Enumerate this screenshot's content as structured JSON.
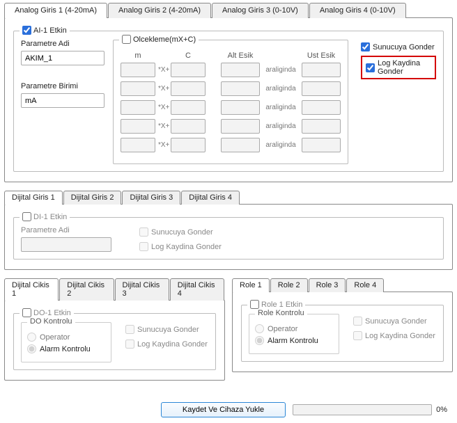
{
  "topTabs": [
    {
      "label": "Analog Giris 1 (4-20mA)"
    },
    {
      "label": "Analog Giris 2 (4-20mA)"
    },
    {
      "label": "Analog Giris 3 (0-10V)"
    },
    {
      "label": "Analog Giris 4 (0-10V)"
    }
  ],
  "ai": {
    "enabledLabel": "AI-1 Etkin",
    "paramNameLabel": "Parametre Adi",
    "paramNameValue": "AKIM_1",
    "paramUnitLabel": "Parametre Birimi",
    "paramUnitValue": "mA",
    "scalingLabel": "Olcekleme(mX+C)",
    "headers": {
      "m": "m",
      "c": "C",
      "altEsik": "Alt Esik",
      "ustEsik": "Ust Esik"
    },
    "rowOp1": "*X+",
    "rowOp2": "araliginda",
    "sunucuyaGonder": "Sunucuya Gonder",
    "logKaydinaGonder": "Log Kaydina Gonder"
  },
  "diTabs": [
    {
      "label": "Dijital Giris 1"
    },
    {
      "label": "Dijital Giris 2"
    },
    {
      "label": "Dijital Giris 3"
    },
    {
      "label": "Dijital Giris 4"
    }
  ],
  "di": {
    "enabledLabel": "DI-1 Etkin",
    "paramNameLabel": "Parametre Adi",
    "sunucuyaGonder": "Sunucuya Gonder",
    "logKaydinaGonder": "Log Kaydina Gonder"
  },
  "doTabs": [
    {
      "label": "Dijital Cikis 1"
    },
    {
      "label": "Dijital Cikis 2"
    },
    {
      "label": "Dijital Cikis 3"
    },
    {
      "label": "Dijital Cikis 4"
    }
  ],
  "do": {
    "enabledLabel": "DO-1 Etkin",
    "kontroluLabel": "DO Kontrolu",
    "operator": "Operator",
    "alarmKontrolu": "Alarm Kontrolu",
    "sunucuyaGonder": "Sunucuya Gonder",
    "logKaydinaGonder": "Log Kaydina Gonder"
  },
  "roleTabs": [
    {
      "label": "Role 1"
    },
    {
      "label": "Role 2"
    },
    {
      "label": "Role 3"
    },
    {
      "label": "Role 4"
    }
  ],
  "role": {
    "enabledLabel": "Role 1 Etkin",
    "kontroluLabel": "Role Kontrolu",
    "operator": "Operator",
    "alarmKontrolu": "Alarm Kontrolu",
    "sunucuyaGonder": "Sunucuya Gonder",
    "logKaydinaGonder": "Log Kaydina Gonder"
  },
  "footer": {
    "saveBtn": "Kaydet Ve Cihaza Yukle",
    "progressText": "0%"
  }
}
